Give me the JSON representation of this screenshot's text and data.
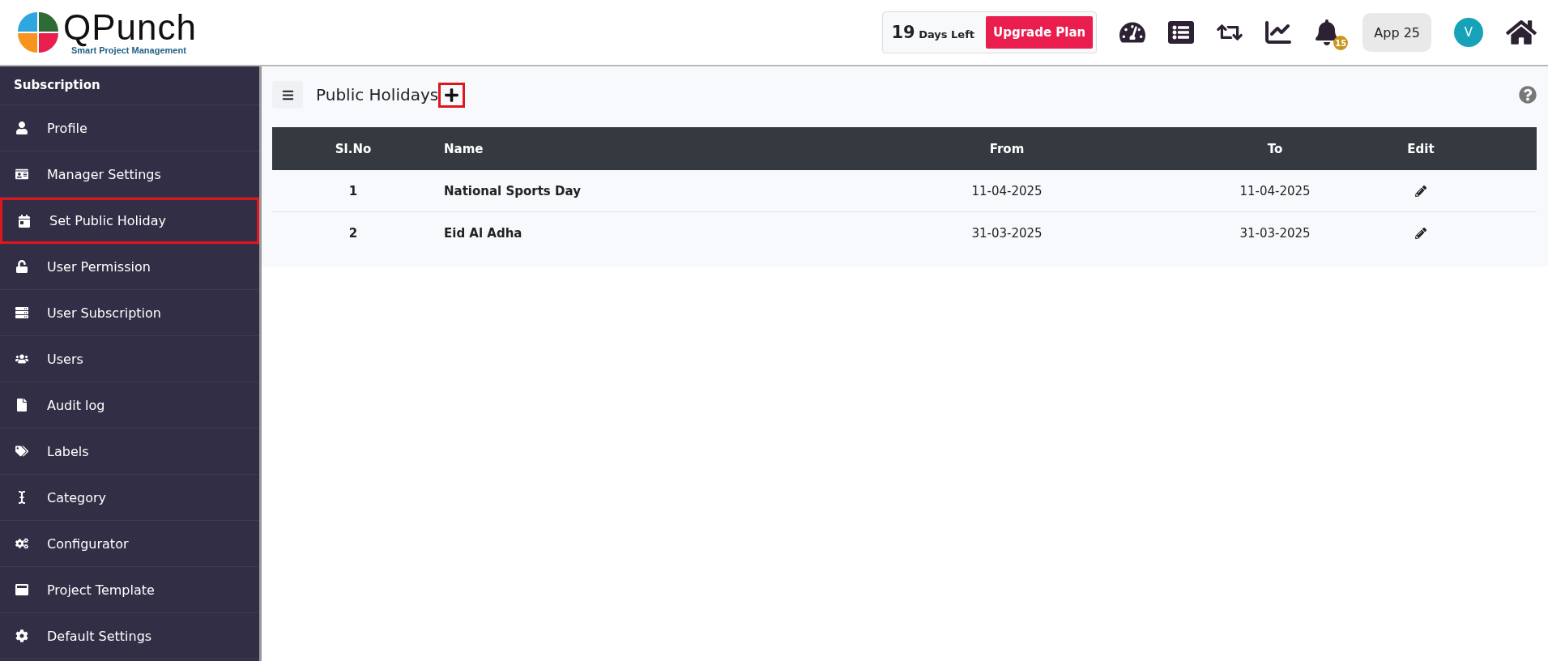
{
  "logo": {
    "name": "QPunch",
    "tagline": "Smart Project Management"
  },
  "trial": {
    "count": "19",
    "label": "Days Left",
    "button": "Upgrade Plan"
  },
  "toolbar": [
    {
      "kind": "dashboard"
    },
    {
      "kind": "list"
    },
    {
      "kind": "sync"
    },
    {
      "kind": "chart"
    },
    {
      "kind": "bell",
      "badge": "15"
    }
  ],
  "app_button": "App 25",
  "avatar": "V",
  "sidebar": {
    "title": "Subscription",
    "items": [
      {
        "label": "Profile",
        "highlighted": false
      },
      {
        "label": "Manager Settings",
        "highlighted": false
      },
      {
        "label": "Set Public Holiday",
        "highlighted": true
      },
      {
        "label": "User Permission",
        "highlighted": false
      },
      {
        "label": "User Subscription",
        "highlighted": false
      },
      {
        "label": "Users",
        "highlighted": false
      },
      {
        "label": "Audit log",
        "highlighted": false
      },
      {
        "label": "Labels",
        "highlighted": false
      },
      {
        "label": "Category",
        "highlighted": false
      },
      {
        "label": "Configurator",
        "highlighted": false
      },
      {
        "label": "Project Template",
        "highlighted": false
      },
      {
        "label": "Default Settings",
        "highlighted": false
      }
    ]
  },
  "page": {
    "title": "Public Holidays",
    "add_highlighted": true
  },
  "table": {
    "columns": [
      "Sl.No",
      "Name",
      "From",
      "To",
      "Edit"
    ],
    "rows": [
      {
        "no": "1",
        "name": "National Sports Day",
        "from": "11-04-2025",
        "to": "11-04-2025"
      },
      {
        "no": "2",
        "name": "Eid Al Adha",
        "from": "31-03-2025",
        "to": "31-03-2025"
      }
    ]
  }
}
